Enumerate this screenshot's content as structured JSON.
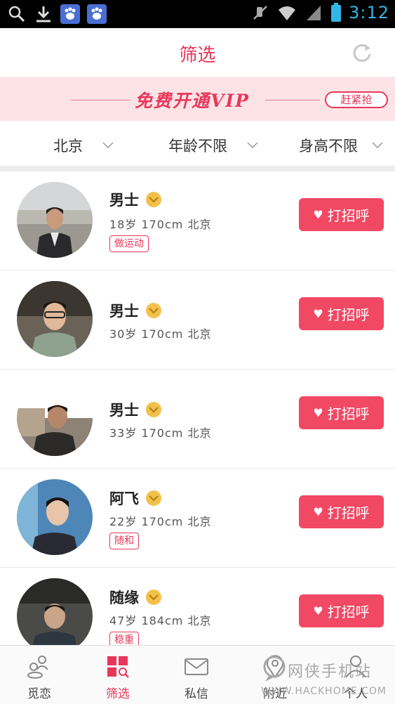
{
  "status_bar": {
    "time": "3:12",
    "icons": [
      "search-icon",
      "download-icon",
      "baidu-icon",
      "baidu-icon",
      "mute-icon",
      "wifi-icon",
      "signal-icon",
      "battery-icon"
    ]
  },
  "header": {
    "title": "筛选",
    "refresh_icon": "refresh-icon"
  },
  "vip_banner": {
    "text": "免费开通VIP",
    "button": "赶紧抢"
  },
  "filters": [
    {
      "label": "北京"
    },
    {
      "label": "年龄不限"
    },
    {
      "label": "身高不限"
    }
  ],
  "users": [
    {
      "name": "男士",
      "info": "18岁  170cm  北京",
      "tag": "做运动",
      "greet": "打招呼"
    },
    {
      "name": "男士",
      "info": "30岁  170cm  北京",
      "tag": "",
      "greet": "打招呼"
    },
    {
      "name": "男士",
      "info": "33岁  170cm  北京",
      "tag": "",
      "greet": "打招呼"
    },
    {
      "name": "阿飞",
      "info": "22岁  170cm  北京",
      "tag": "随和",
      "greet": "打招呼"
    },
    {
      "name": "随缘",
      "info": "47岁  184cm  北京",
      "tag": "稳重",
      "greet": "打招呼"
    }
  ],
  "bottom_nav": [
    {
      "label": "觅恋",
      "icon": "people-icon",
      "active": false
    },
    {
      "label": "筛选",
      "icon": "filter-grid-icon",
      "active": true
    },
    {
      "label": "私信",
      "icon": "mail-icon",
      "active": false
    },
    {
      "label": "附近",
      "icon": "location-icon",
      "active": false
    },
    {
      "label": "个人",
      "icon": "user-icon",
      "active": false
    }
  ],
  "watermark": {
    "text": "网侠手机站",
    "sub": "WWW.HACKHOME.COM"
  },
  "colors": {
    "accent": "#e8375a",
    "button": "#f14864",
    "banner_bg": "#fde3e6",
    "badge": "#f3c14b"
  }
}
